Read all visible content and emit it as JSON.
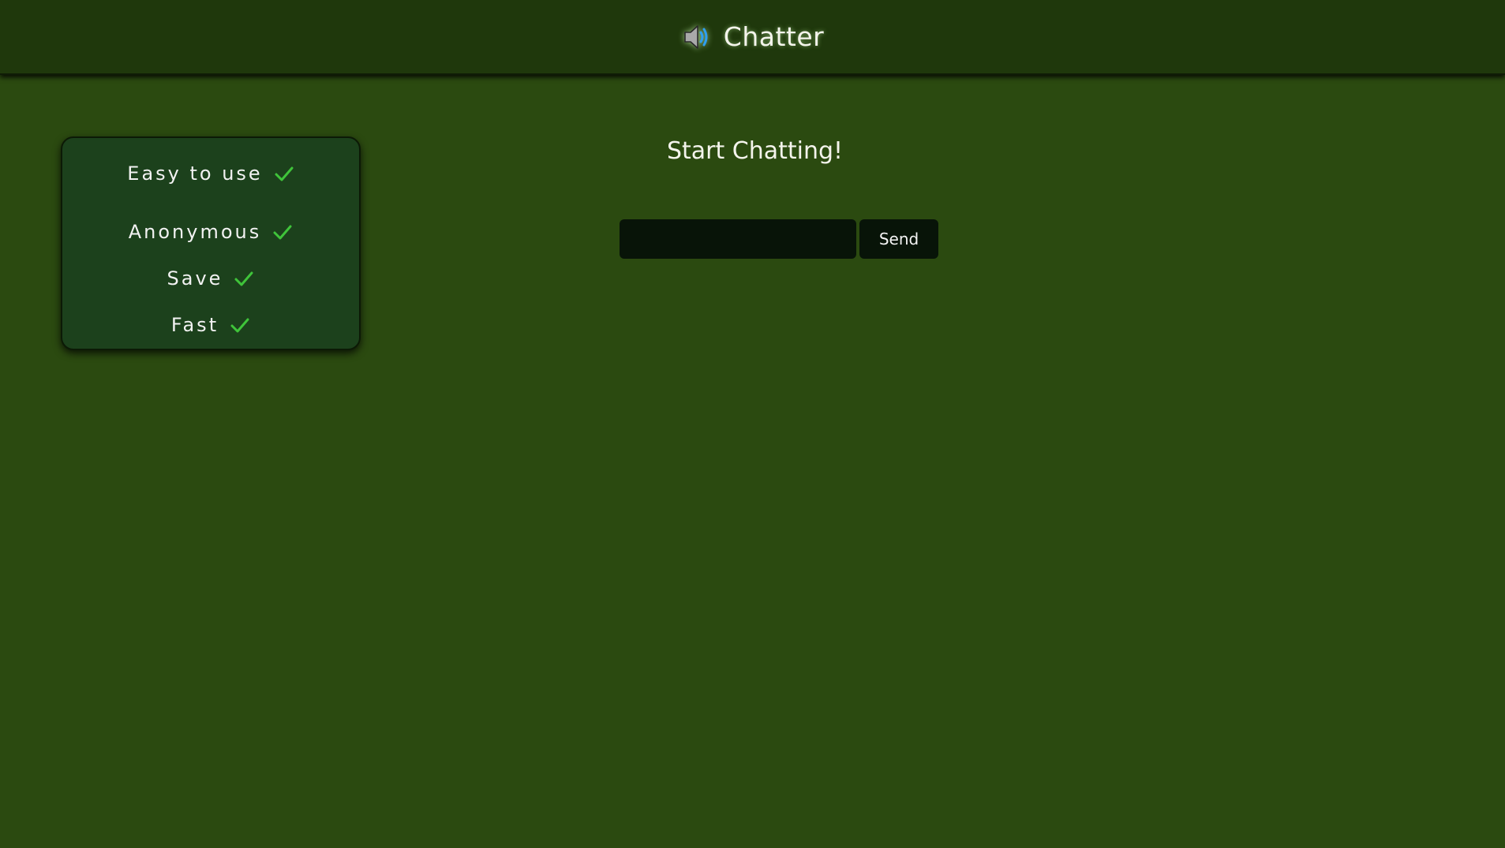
{
  "header": {
    "title": "Chatter",
    "icon": "speaker-icon"
  },
  "features": [
    {
      "label": "Easy to use",
      "icon": "check-icon"
    },
    {
      "label": "Anonymous",
      "icon": "check-icon"
    },
    {
      "label": "Save",
      "icon": "check-icon"
    },
    {
      "label": "Fast",
      "icon": "check-icon"
    }
  ],
  "main": {
    "heading": "Start Chatting!",
    "input_value": "",
    "input_placeholder": "",
    "send_label": "Send"
  },
  "colors": {
    "background": "#2b4a10",
    "header_bg": "#1f380c",
    "card_bg": "#1c411c",
    "input_bg": "#081408",
    "check": "#3fc43a"
  }
}
